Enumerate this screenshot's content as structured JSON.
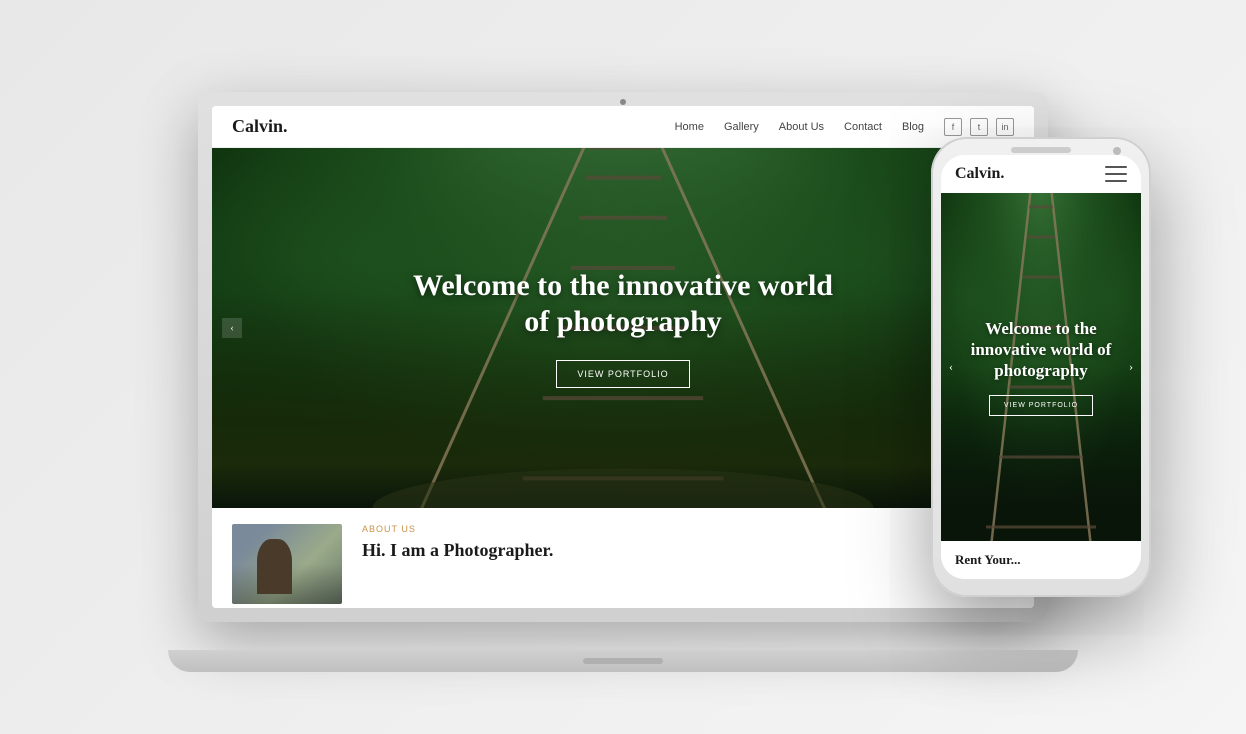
{
  "laptop": {
    "nav": {
      "logo": "Calvin.",
      "links": [
        "Home",
        "Gallery",
        "About Us",
        "Contact",
        "Blog"
      ],
      "social": [
        "f",
        "t",
        "in"
      ]
    },
    "hero": {
      "title": "Welcome to the innovative world of photography",
      "btn_label": "VIEW PORTFOLIO",
      "arrow_left": "‹"
    },
    "about": {
      "label": "ABOUT US",
      "title": "Hi. I am a Photographer."
    }
  },
  "phone": {
    "nav": {
      "logo": "Calvin.",
      "menu_icon": "☰"
    },
    "hero": {
      "title": "Welcome to the innovative world of photography",
      "btn_label": "VIEW PORTFOLIO",
      "arrow_left": "‹",
      "arrow_right": "›"
    },
    "below": {
      "text": "Rent Your..."
    }
  }
}
